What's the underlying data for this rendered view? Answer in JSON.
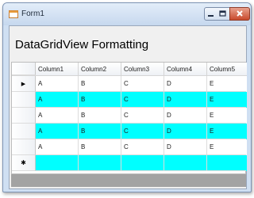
{
  "window": {
    "title": "Form1",
    "icon": "form-app-icon",
    "controls": [
      "minimize-icon",
      "maximize-icon",
      "close-icon"
    ]
  },
  "heading": "DataGridView Formatting",
  "grid": {
    "columns": [
      "Column1",
      "Column2",
      "Column3",
      "Column4",
      "Column5"
    ],
    "rows": [
      [
        "A",
        "B",
        "C",
        "D",
        "E"
      ],
      [
        "A",
        "B",
        "C",
        "D",
        "E"
      ],
      [
        "A",
        "B",
        "C",
        "D",
        "E"
      ],
      [
        "A",
        "B",
        "C",
        "D",
        "E"
      ],
      [
        "A",
        "B",
        "C",
        "D",
        "E"
      ]
    ],
    "current_row_glyph": "▶",
    "new_row_glyph": "✱",
    "colors": {
      "alternating_row": "#00ffff",
      "row": "#ffffff"
    }
  }
}
